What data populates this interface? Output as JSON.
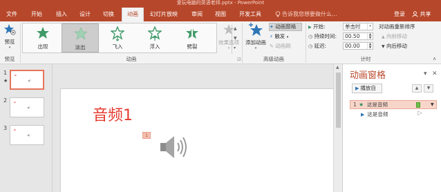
{
  "window": {
    "title": "爱玩电脑的英语老师.pptx - PowerPoint"
  },
  "tabs": [
    {
      "label": "文件",
      "active": false
    },
    {
      "label": "开始",
      "active": false
    },
    {
      "label": "插入",
      "active": false
    },
    {
      "label": "设计",
      "active": false
    },
    {
      "label": "切换",
      "active": false
    },
    {
      "label": "动画",
      "active": true
    },
    {
      "label": "幻灯片放映",
      "active": false
    },
    {
      "label": "审阅",
      "active": false
    },
    {
      "label": "视图",
      "active": false
    },
    {
      "label": "开发工具",
      "active": false
    }
  ],
  "tellme": "告诉我您想要做什么...",
  "account": {
    "login": "登录",
    "share": "共享"
  },
  "ribbon": {
    "preview": {
      "label": "预览",
      "group": "预览"
    },
    "effects": {
      "items": [
        {
          "label": "出现",
          "selected": false
        },
        {
          "label": "淡出",
          "selected": true
        },
        {
          "label": "飞入",
          "selected": false
        },
        {
          "label": "浮入",
          "selected": false
        },
        {
          "label": "劈裂",
          "selected": false
        }
      ],
      "effect_options": "效果选项",
      "group": "动画"
    },
    "advanced": {
      "add_animation": "添加动画",
      "animation_pane": "动画窗格",
      "trigger": "触发",
      "painter": "动画刷",
      "group": "高级动画"
    },
    "timing": {
      "start_label": "开始:",
      "start_value": "单击时",
      "duration_label": "持续时间:",
      "duration_value": "00.50",
      "delay_label": "延迟:",
      "delay_value": "00.00",
      "reorder_title": "对动画重新排序",
      "move_earlier": "向前移动",
      "move_later": "向后移动",
      "group": "计时"
    }
  },
  "slides": [
    {
      "number": "1",
      "has_animation": "★",
      "selected": true
    },
    {
      "number": "2",
      "has_animation": "",
      "selected": false
    },
    {
      "number": "3",
      "has_animation": "",
      "selected": false
    }
  ],
  "slide": {
    "title": "音频1",
    "animation_tag": "1"
  },
  "animation_pane": {
    "title": "动画窗格",
    "play_button": "播放自",
    "items": [
      {
        "index": "1",
        "label": "这是音频"
      },
      {
        "index": "",
        "label": "这是音频"
      }
    ]
  },
  "colors": {
    "accent": "#b7472a",
    "slide_title": "#e4392f",
    "selected_item": "#f8d5c9"
  }
}
